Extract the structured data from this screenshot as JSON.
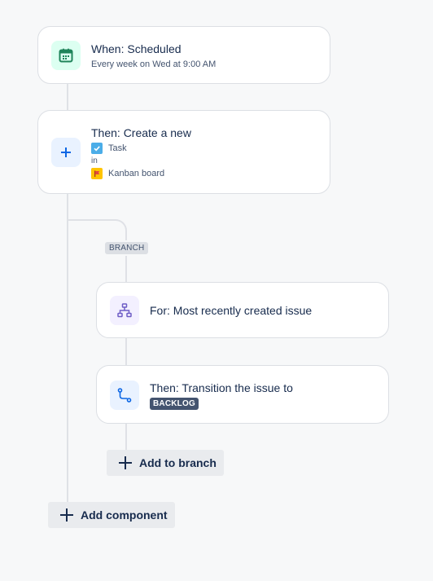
{
  "trigger": {
    "title": "When: Scheduled",
    "subtitle": "Every week on Wed at 9:00 AM",
    "icon": "calendar-icon",
    "accent": "#1f845a",
    "icon_bg": "#dcfff1"
  },
  "create_action": {
    "title": "Then: Create a new",
    "issue_type": "Task",
    "connector": "in",
    "board": "Kanban board",
    "icon": "plus-icon",
    "accent": "#0c66e4",
    "icon_bg": "#e9f2ff"
  },
  "branch": {
    "label": "BRANCH",
    "for_card": {
      "title": "For: Most recently created issue",
      "icon": "hierarchy-icon",
      "accent": "#6e5dc6",
      "icon_bg": "#f3f0ff"
    },
    "transition_card": {
      "title": "Then: Transition the issue to",
      "status": "BACKLOG",
      "icon": "transition-icon",
      "accent": "#0c66e4",
      "icon_bg": "#e9f2ff"
    },
    "add_button_label": "Add to branch"
  },
  "add_component_label": "Add component"
}
